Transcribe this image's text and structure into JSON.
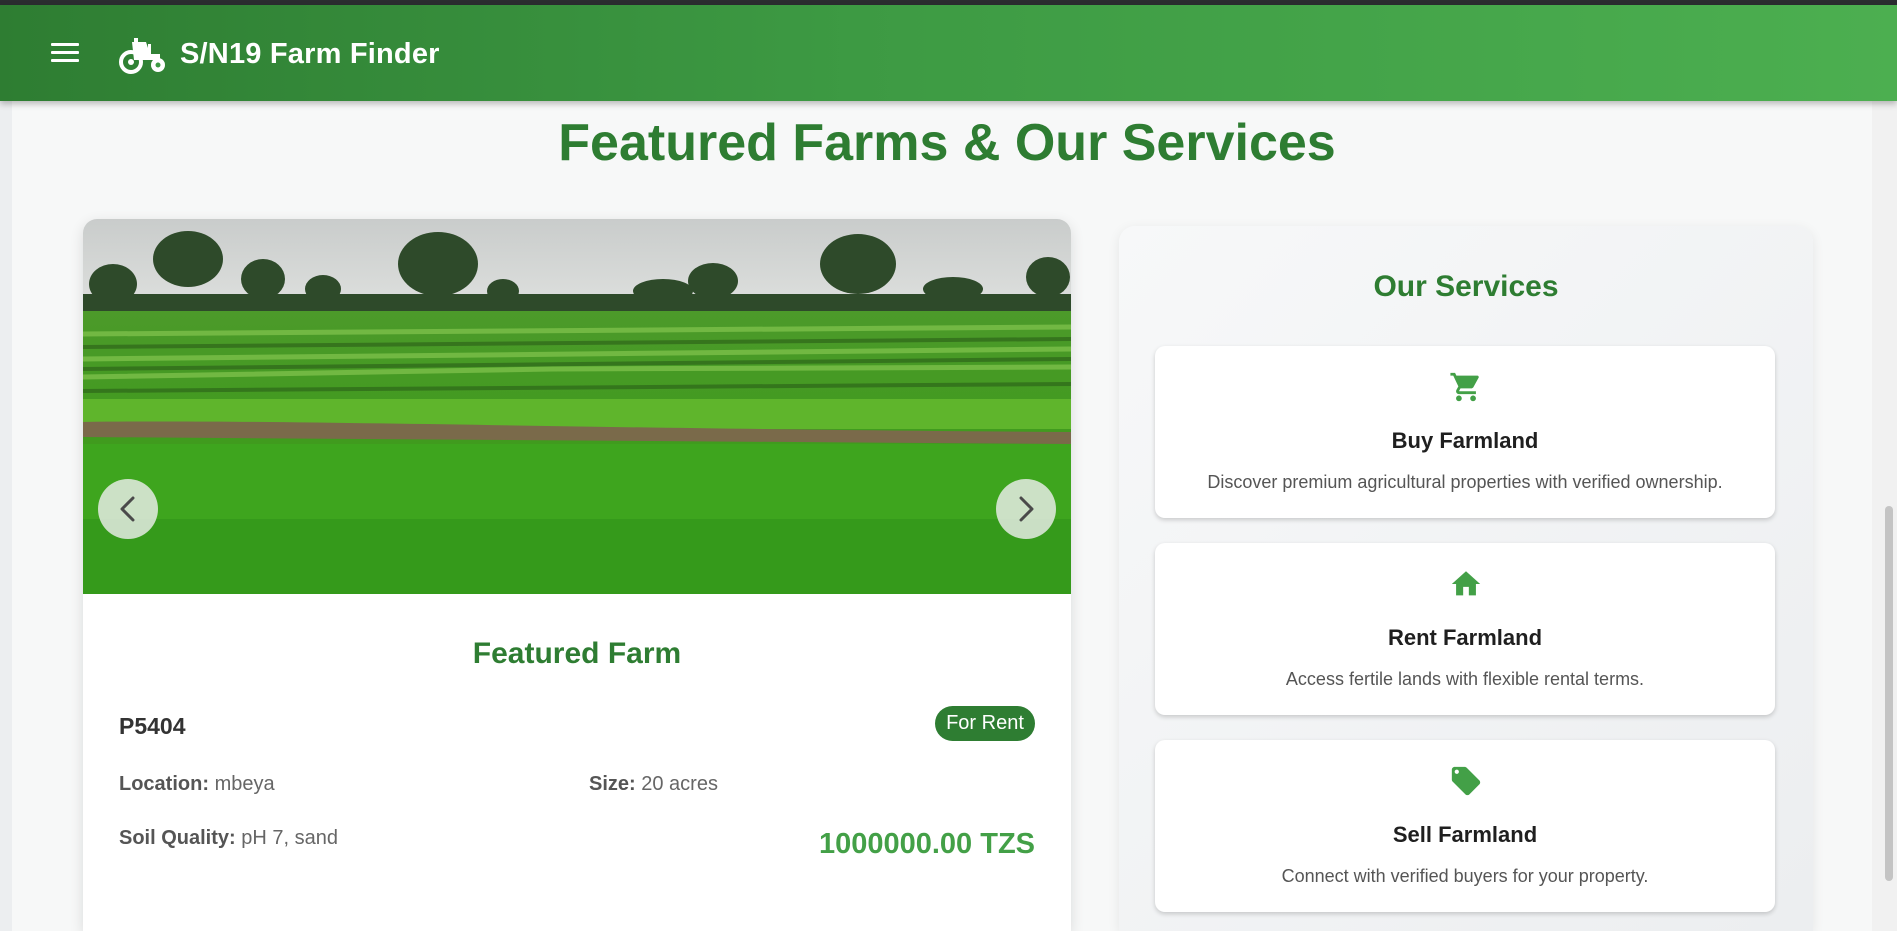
{
  "app": {
    "title": "S/N19 Farm Finder"
  },
  "page": {
    "section_title": "Featured Farms & Our Services"
  },
  "featured": {
    "heading": "Featured Farm",
    "id": "P5404",
    "status": "For Rent",
    "location_label": "Location:",
    "location_value": "mbeya",
    "size_label": "Size:",
    "size_value": "20 acres",
    "soil_label": "Soil Quality:",
    "soil_value": "pH 7, sand",
    "price": "1000000.00 TZS"
  },
  "services": {
    "title": "Our Services",
    "items": [
      {
        "icon": "cart-icon",
        "name": "Buy Farmland",
        "desc": "Discover premium agricultural properties with verified ownership."
      },
      {
        "icon": "home-icon",
        "name": "Rent Farmland",
        "desc": "Access fertile lands with flexible rental terms."
      },
      {
        "icon": "tag-icon",
        "name": "Sell Farmland",
        "desc": "Connect with verified buyers for your property."
      }
    ]
  },
  "colors": {
    "brand_dark": "#2e7d32",
    "brand_light": "#4caf50"
  }
}
